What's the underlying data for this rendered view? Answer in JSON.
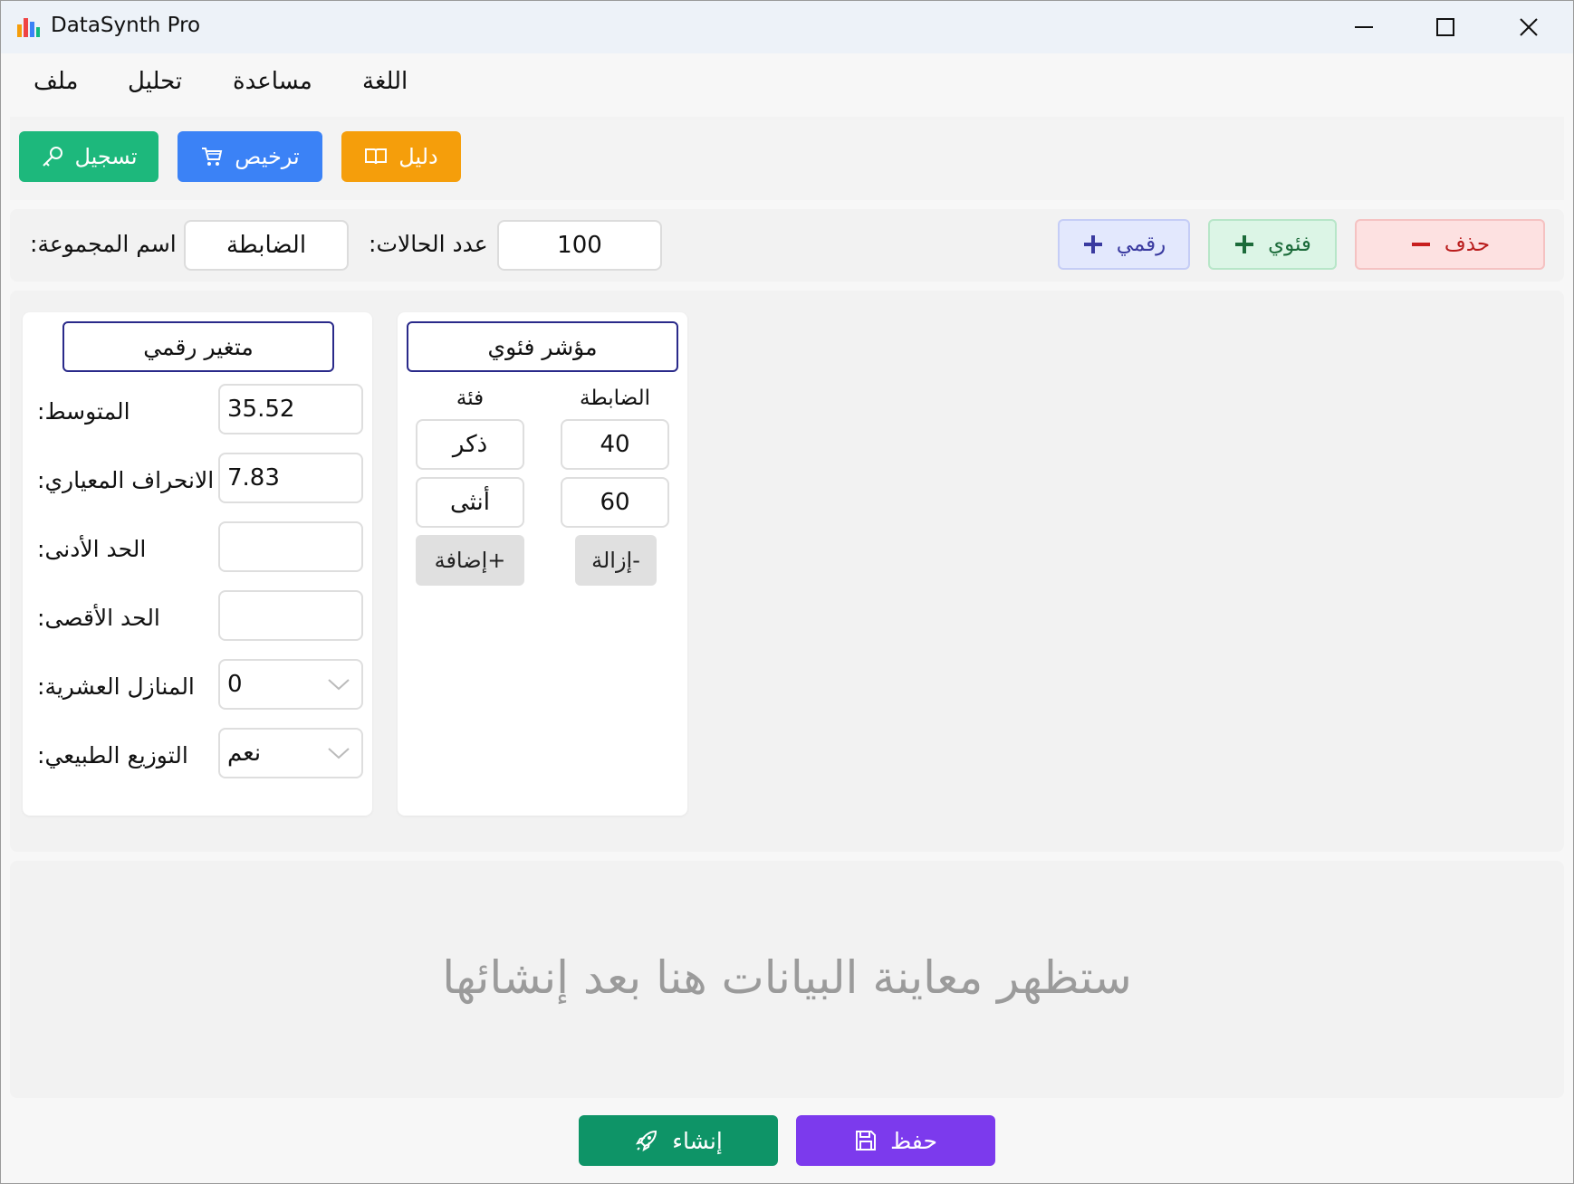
{
  "window": {
    "title": "DataSynth Pro"
  },
  "menu": {
    "file": "ملف",
    "analysis": "تحليل",
    "help": "مساعدة",
    "language": "اللغة"
  },
  "toolbar": {
    "register_label": "تسجيل",
    "license_label": "ترخيص",
    "guide_label": "دليل",
    "colors": {
      "register": "#1db87c",
      "license": "#3b82f6",
      "guide": "#f59e0b"
    }
  },
  "controls": {
    "group_name_label": ":اسم المجموعة",
    "group_name_value": "الضابطة",
    "cases_label": ":عدد الحالات",
    "cases_value": "100",
    "add_numeric_label": "رقمي",
    "add_categorical_label": "فئوي",
    "delete_label": "حذف"
  },
  "numeric_card": {
    "title": "متغير رقمي",
    "rows": [
      {
        "label": ":المتوسط",
        "value": "35.52"
      },
      {
        "label": ":الانحراف المعياري",
        "value": "7.83"
      },
      {
        "label": ":الحد الأدنى",
        "value": ""
      },
      {
        "label": ":الحد الأقصى",
        "value": ""
      },
      {
        "label": ":المنازل العشرية",
        "value": "0"
      },
      {
        "label": ":التوزيع الطبيعي",
        "value": "نعم"
      }
    ]
  },
  "categorical_card": {
    "title": "مؤشر فئوي",
    "col_category": "فئة",
    "col_group": "الضابطة",
    "rows": [
      {
        "category": "ذكر",
        "count": "40"
      },
      {
        "category": "أنثى",
        "count": "60"
      }
    ],
    "add_label": "إضافة+",
    "remove_label": "إزالة-"
  },
  "preview": {
    "placeholder": "ستظهر معاينة البيانات هنا بعد إنشائها"
  },
  "actions": {
    "create_label": "إنشاء",
    "save_label": "حفظ",
    "colors": {
      "create": "#0e9467",
      "save": "#7c3aed"
    }
  }
}
